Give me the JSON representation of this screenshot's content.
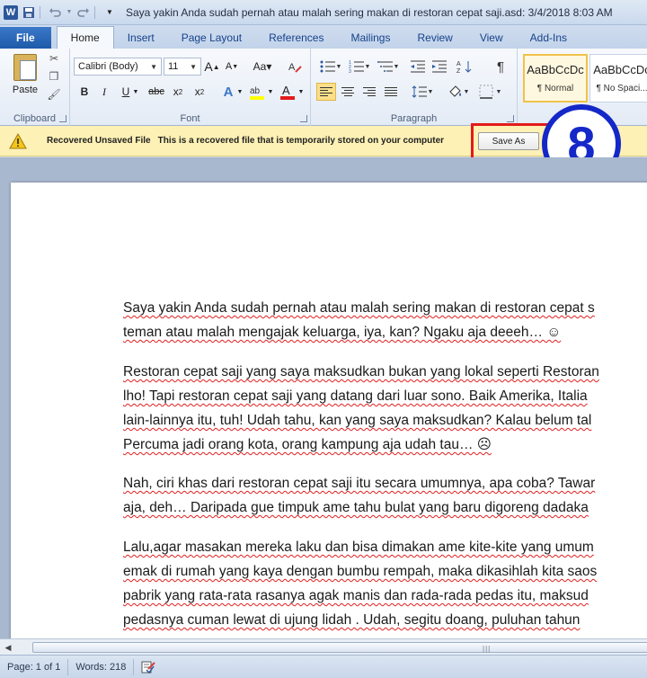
{
  "titlebar": {
    "title": "Saya yakin Anda sudah pernah atau malah sering makan di restoran cepat saji.asd: 3/4/2018 8:03 AM",
    "app_icon": "W"
  },
  "tabs": [
    "File",
    "Home",
    "Insert",
    "Page Layout",
    "References",
    "Mailings",
    "Review",
    "View",
    "Add-Ins"
  ],
  "ribbon": {
    "clipboard": {
      "paste_label": "Paste",
      "group_label": "Clipboard"
    },
    "font": {
      "font_name": "Calibri (Body)",
      "font_size": "11",
      "group_label": "Font",
      "text_effects": "A"
    },
    "paragraph": {
      "group_label": "Paragraph"
    },
    "styles": [
      {
        "sample": "AaBbCcDc",
        "name": "¶ Normal"
      },
      {
        "sample": "AaBbCcDc",
        "name": "¶ No Spaci..."
      }
    ]
  },
  "infobar": {
    "title": "Recovered Unsaved File",
    "message": "This is a recovered file that is temporarily stored on your computer",
    "button": "Save As",
    "step_number": "8"
  },
  "document": {
    "paragraphs": [
      [
        "Saya yakin Anda sudah pernah atau malah sering makan di restoran cepat s",
        "teman atau malah mengajak keluarga, iya, kan? Ngaku aja deeeh… ☺"
      ],
      [
        "Restoran cepat saji yang saya maksudkan bukan yang lokal seperti Restoran",
        "lho! Tapi restoran cepat saji yang datang dari luar sono. Baik Amerika, Italia",
        "lain-lainnya itu, tuh! Udah tahu, kan yang saya maksudkan? Kalau belum tal",
        "Percuma jadi orang kota, orang kampung aja udah tau… ☹"
      ],
      [
        "Nah, ciri khas dari restoran cepat saji itu secara umumnya, apa coba? Tawar",
        "aja, deh…  Daripada gue timpuk ame tahu bulat yang baru digoreng dadaka"
      ],
      [
        "Lalu,agar masakan mereka laku dan bisa dimakan ame kite-kite yang umum",
        "emak di rumah yang kaya dengan bumbu rempah, maka dikasihlah kita saos",
        "pabrik yang rata-rata rasanya agak manis dan rada-rada pedas itu, maksud",
        "pedasnya cuman lewat di ujung lidah . Udah, segitu doang, puluhan tahun"
      ]
    ]
  },
  "statusbar": {
    "page": "Page: 1 of 1",
    "words": "Words: 218"
  }
}
